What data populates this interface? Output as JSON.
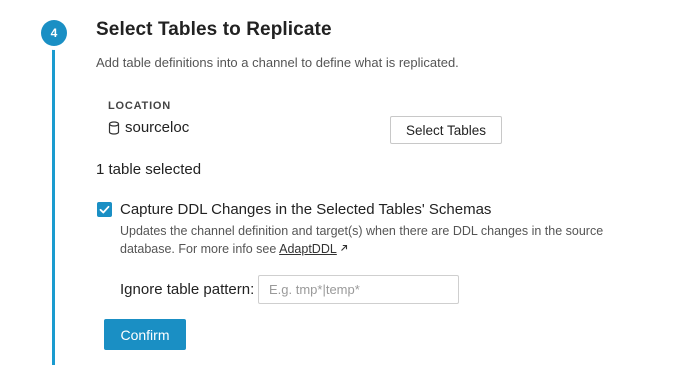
{
  "step": {
    "number": "4",
    "title": "Select Tables to Replicate",
    "subtitle": "Add table definitions into a channel to define what is replicated."
  },
  "location": {
    "label": "LOCATION",
    "icon": "database-icon",
    "name": "sourceloc"
  },
  "select_tables_button": "Select Tables",
  "selected_count": "1 table selected",
  "capture_ddl": {
    "checked": true,
    "label": "Capture DDL Changes in the Selected Tables' Schemas",
    "description": "Updates the channel definition and target(s) when there are DDL changes in the source database. For more info see ",
    "link_text": "AdaptDDL",
    "link_icon": "external-link-icon"
  },
  "ignore_pattern": {
    "label": "Ignore table pattern:",
    "value": "",
    "placeholder": "E.g. tmp*|temp*"
  },
  "confirm_button": "Confirm",
  "colors": {
    "accent": "#1a8fc4",
    "rail": "#1a9bcf"
  }
}
